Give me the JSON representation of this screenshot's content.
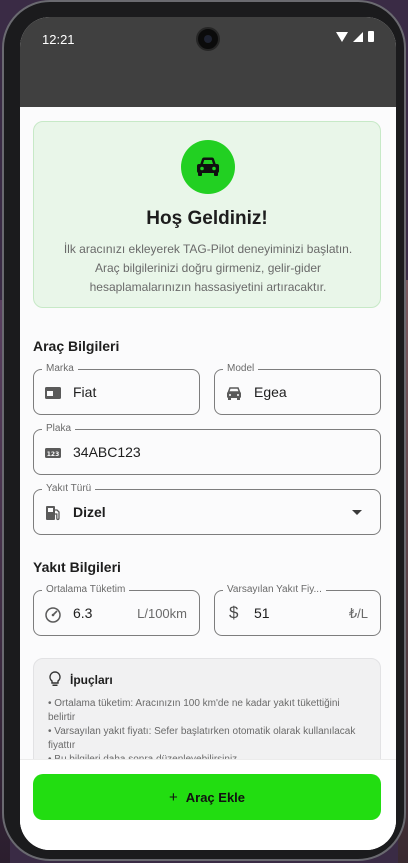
{
  "status": {
    "time": "12:21"
  },
  "welcome": {
    "title": "Hoş Geldiniz!",
    "text": "İlk aracınızı ekleyerek TAG-Pilot deneyiminizi başlatın. Araç bilgilerinizi doğru girmeniz, gelir-gider hesaplamalarınızın hassasiyetini artıracaktır."
  },
  "vehicle_section": {
    "title": "Araç Bilgileri",
    "brand": {
      "label": "Marka",
      "value": "Fiat"
    },
    "model": {
      "label": "Model",
      "value": "Egea"
    },
    "plate": {
      "label": "Plaka",
      "value": "34ABC123"
    },
    "fuel_type": {
      "label": "Yakıt Türü",
      "value": "Dizel"
    }
  },
  "fuel_section": {
    "title": "Yakıt Bilgileri",
    "consumption": {
      "label": "Ortalama Tüketim",
      "value": "6.3",
      "suffix": "L/100km"
    },
    "fuel_price": {
      "label": "Varsayılan Yakıt Fiy...",
      "value": "51",
      "suffix": "₺/L"
    }
  },
  "tips": {
    "title": "İpuçları",
    "line1": "• Ortalama tüketim: Aracınızın 100 km'de ne kadar yakıt tükettiğini belirtir",
    "line2": "• Varsayılan yakıt fiyatı: Sefer başlatırken otomatik olarak kullanılacak fiyattır",
    "line3": "• Bu bilgileri daha sonra düzenleyebilirsiniz"
  },
  "actions": {
    "add_icon": "+",
    "add_label": "Araç Ekle"
  },
  "colors": {
    "accent": "#22DD11",
    "statusbar": "#404040"
  },
  "icons": [
    "car-icon",
    "card-icon",
    "car-small-icon",
    "plate-123-icon",
    "fuel-pump-icon",
    "dropdown-arrow-icon",
    "speedometer-icon",
    "dollar-icon",
    "lightbulb-icon",
    "plus-icon"
  ]
}
